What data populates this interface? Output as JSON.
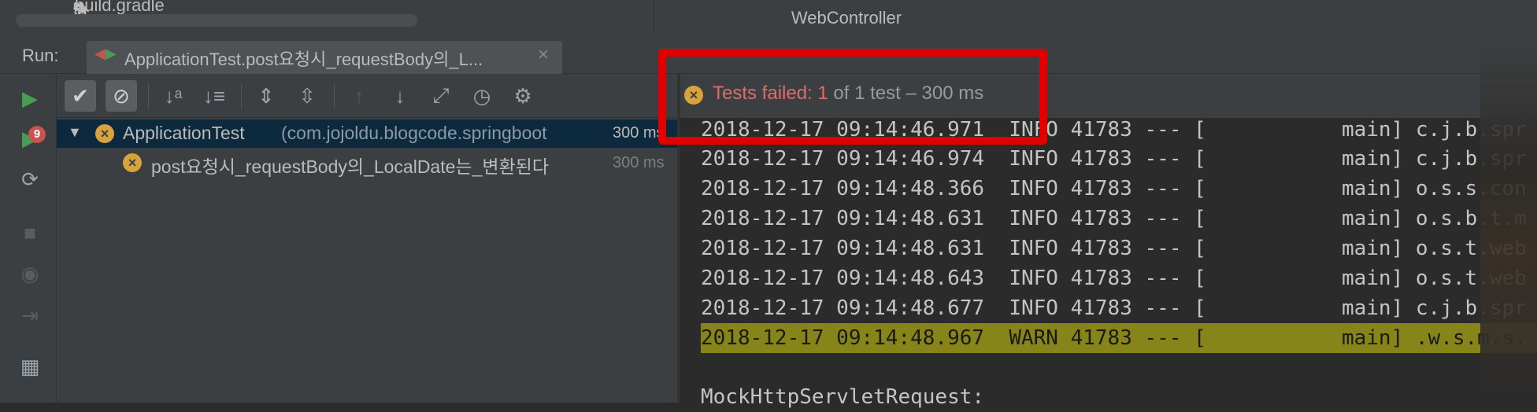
{
  "project": {
    "build_file": "build.gradle"
  },
  "editor": {
    "title": "WebController"
  },
  "run": {
    "label": "Run:",
    "tab_title": "ApplicationTest.post요청시_requestBody의_L...",
    "tab_close": "×"
  },
  "gutter": {
    "rerun_failed_count": "9"
  },
  "tree": {
    "toggle": "▼",
    "root": {
      "name": "ApplicationTest",
      "package": "(com.jojoldu.blogcode.springboot",
      "time": "300 ms"
    },
    "child": {
      "name": "post요청시_requestBody의_LocalDate는_변환된다",
      "time": "300 ms"
    }
  },
  "status": {
    "failed_label": "Tests failed: ",
    "failed_count": "1",
    "of_text": " of 1 test",
    "duration": " – 300 ms"
  },
  "console": {
    "lines": [
      "2018-12-17 09:14:46.971  INFO 41783 --- [           main] c.j.b.spr",
      "2018-12-17 09:14:46.974  INFO 41783 --- [           main] c.j.b.spr",
      "2018-12-17 09:14:48.366  INFO 41783 --- [           main] o.s.s.con",
      "2018-12-17 09:14:48.631  INFO 41783 --- [           main] o.s.b.t.m",
      "2018-12-17 09:14:48.631  INFO 41783 --- [           main] o.s.t.web",
      "2018-12-17 09:14:48.643  INFO 41783 --- [           main] o.s.t.web",
      "2018-12-17 09:14:48.677  INFO 41783 --- [           main] c.j.b.spr",
      "2018-12-17 09:14:48.967  WARN 41783 --- [           main] .w.s.m.s.",
      "",
      "MockHttpServletRequest:"
    ]
  },
  "colors": {
    "fail": "#d8a23c",
    "failed_text": "#e06c6c",
    "warn_highlight": "#87851a",
    "selection": "#0d293e",
    "annotation_box": "#e10000"
  }
}
